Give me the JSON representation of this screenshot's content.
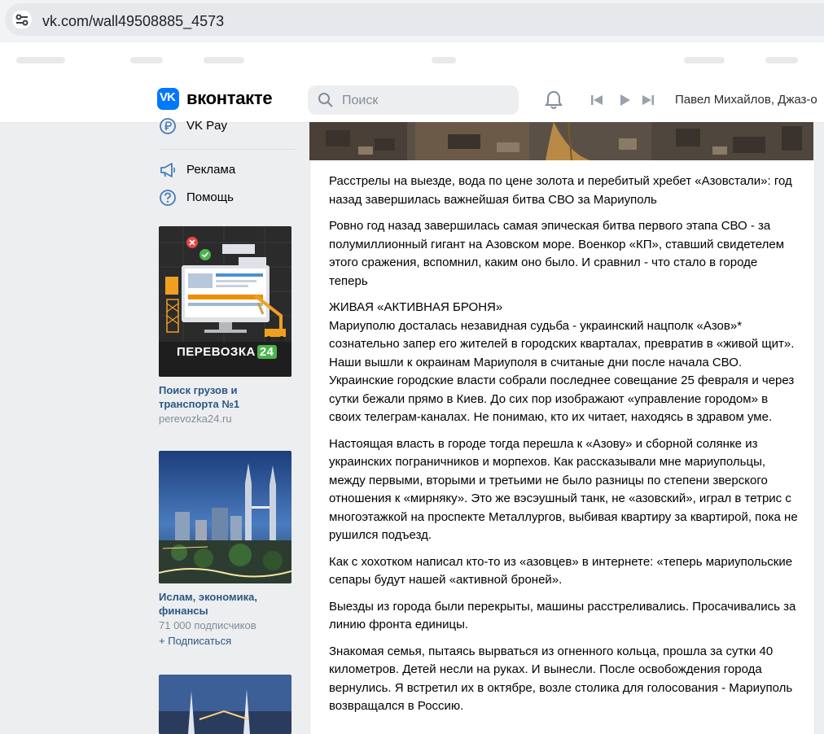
{
  "browser": {
    "url": "vk.com/wall49508885_4573"
  },
  "header": {
    "brand": "вконтакте",
    "search_placeholder": "Поиск",
    "now_playing": "Павел Михайлов, Джаз-о"
  },
  "menu": {
    "items": [
      {
        "label": "VK Pay",
        "icon": "vkpay-icon"
      },
      {
        "label": "Реклама",
        "icon": "megaphone-icon"
      },
      {
        "label": "Помощь",
        "icon": "help-icon"
      }
    ]
  },
  "ads": [
    {
      "image_text": "ПЕРЕВОЗКА",
      "image_badge": "24",
      "title": "Поиск грузов и транспорта №1",
      "subtitle": "perevozka24.ru"
    },
    {
      "title": "Ислам, экономика, финансы",
      "subtitle": "71 000 подписчиков",
      "action": "Подписаться"
    }
  ],
  "post": {
    "paragraphs": [
      "Расстрелы на выезде, вода по цене золота и перебитый хребет «Азовстали»: год назад завершилась важнейшая битва СВО за Мариуполь",
      "Ровно год назад завершилась самая эпическая битва первого этапа СВО - за полумиллионный гигант на Азовском море. Военкор «КП», ставший свидетелем этого сражения, вспомнил, каким оно было. И сравнил - что стало в городе теперь",
      "ЖИВАЯ «АКТИВНАЯ БРОНЯ»",
      "Мариуполю досталась незавидная судьба - украинский нацполк «Азов»* сознательно запер его жителей в городских кварталах, превратив в «живой щит». Наши вышли к окраинам Мариуполя в считаные дни после начала СВО. Украинские городские власти собрали последнее совещание 25 февраля и через сутки бежали прямо в Киев. До сих пор изображают «управление городом» в своих телеграм-каналах. Не понимаю, кто их читает, находясь в здравом уме.",
      "Настоящая власть в городе тогда перешла к «Азову» и сборной солянке из украинских пограничников и морпехов. Как рассказывали мне мариупольцы, между первыми, вторыми и третьими не было разницы по степени зверского отношения к «мирняку». Это же вэсэушный танк, не «азовский», играл в тетрис с многоэтажкой на проспекте Металлургов, выбивая квартиру за квартирой, пока не рушился подъезд.",
      "Как с хохотком написал кто-то из «азовцев» в интернете: «теперь мариупольские сепары будут нашей «активной броней».",
      "Выезды из города были перекрыты, машины расстреливались. Просачивались за линию фронта единицы.",
      "Знакомая семья, пытаясь вырваться из огненного кольца, прошла за сутки 40 километров. Детей несли на руках. И вынесли. После освобождения города вернулись. Я встретил их в октябре, возле столика для голосования - Мариуполь возвращался в Россию."
    ]
  },
  "colors": {
    "vk_blue": "#0077ff",
    "link": "#2a5885",
    "page_bg": "#edeef0"
  }
}
